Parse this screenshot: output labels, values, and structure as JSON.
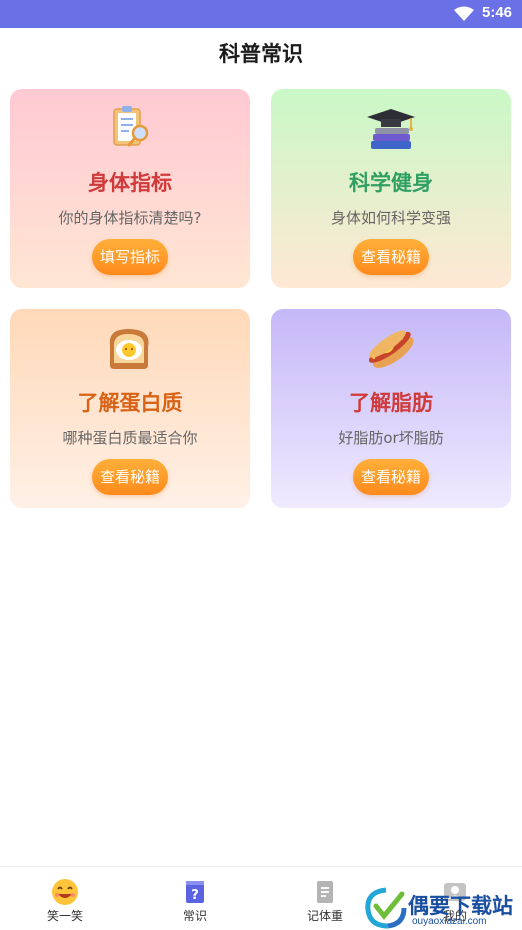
{
  "status_bar": {
    "time": "5:46",
    "icons": [
      "wifi-icon"
    ]
  },
  "page": {
    "title": "科普常识"
  },
  "cards": [
    {
      "icon": "clipboard-magnifier-icon",
      "title": "身体指标",
      "subtitle": "你的身体指标清楚吗?",
      "button": "填写指标"
    },
    {
      "icon": "books-graduation-cap-icon",
      "title": "科学健身",
      "subtitle": "身体如何科学变强",
      "button": "查看秘籍"
    },
    {
      "icon": "toast-egg-icon",
      "title": "了解蛋白质",
      "subtitle": "哪种蛋白质最适合你",
      "button": "查看秘籍"
    },
    {
      "icon": "hotdog-icon",
      "title": "了解脂肪",
      "subtitle": "好脂肪or坏脂肪",
      "button": "查看秘籍"
    }
  ],
  "tabs": [
    {
      "icon": "smile-emoji-icon",
      "label": "笑一笑",
      "active": false
    },
    {
      "icon": "question-book-icon",
      "label": "常识",
      "active": true
    },
    {
      "icon": "document-icon",
      "label": "记体重",
      "active": false
    },
    {
      "icon": "profile-icon",
      "label": "我的",
      "active": false
    }
  ],
  "watermark": {
    "title": "偶要下载站",
    "url": "ouyaoxiazai.com"
  },
  "colors": {
    "status_bar": "#6a70e6",
    "button_orange": "#ff9a26",
    "active_tab": "#5b63e0"
  }
}
